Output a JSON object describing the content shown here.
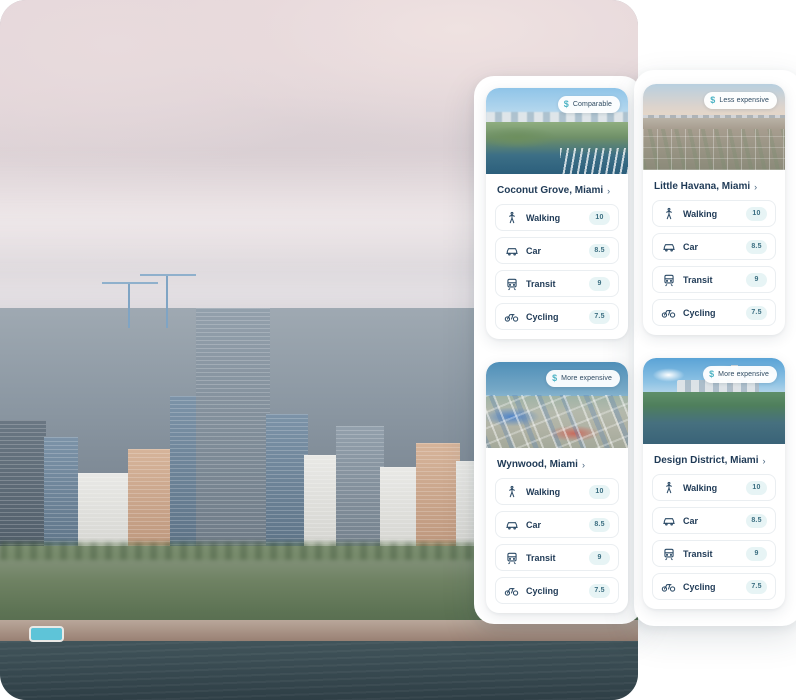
{
  "hero": {
    "alt": "aerial-photo-miami-brickell-waterfront-skyline"
  },
  "panels": [
    {
      "name": "left-card-panel"
    },
    {
      "name": "right-card-panel"
    }
  ],
  "badge_icon": "$",
  "title_chevron": "›",
  "cards": [
    {
      "id": "coconut-grove",
      "title": "Coconut Grove, Miami",
      "badge": "Comparable",
      "thumb_class": "coconut",
      "thumb_alt": "aerial-photo-coconut-grove-marina",
      "metrics": [
        {
          "icon": "walking-icon",
          "label": "Walking",
          "score": "10"
        },
        {
          "icon": "car-icon",
          "label": "Car",
          "score": "8.5"
        },
        {
          "icon": "transit-icon",
          "label": "Transit",
          "score": "9"
        },
        {
          "icon": "cycling-icon",
          "label": "Cycling",
          "score": "7.5"
        }
      ]
    },
    {
      "id": "little-havana",
      "title": "Little Havana, Miami",
      "badge": "Less expensive",
      "thumb_class": "havana",
      "thumb_alt": "aerial-photo-little-havana-street-grid",
      "metrics": [
        {
          "icon": "walking-icon",
          "label": "Walking",
          "score": "10"
        },
        {
          "icon": "car-icon",
          "label": "Car",
          "score": "8.5"
        },
        {
          "icon": "transit-icon",
          "label": "Transit",
          "score": "9"
        },
        {
          "icon": "cycling-icon",
          "label": "Cycling",
          "score": "7.5"
        }
      ]
    },
    {
      "id": "wynwood",
      "title": "Wynwood, Miami",
      "badge": "More expensive",
      "thumb_class": "wynwood",
      "thumb_alt": "aerial-photo-wynwood-warehouse-district",
      "metrics": [
        {
          "icon": "walking-icon",
          "label": "Walking",
          "score": "10"
        },
        {
          "icon": "car-icon",
          "label": "Car",
          "score": "8.5"
        },
        {
          "icon": "transit-icon",
          "label": "Transit",
          "score": "9"
        },
        {
          "icon": "cycling-icon",
          "label": "Cycling",
          "score": "7.5"
        }
      ]
    },
    {
      "id": "design-district",
      "title": "Design District, Miami",
      "badge": "More expensive",
      "thumb_class": "design",
      "thumb_alt": "aerial-photo-design-district-waterfront-towers",
      "metrics": [
        {
          "icon": "walking-icon",
          "label": "Walking",
          "score": "10"
        },
        {
          "icon": "car-icon",
          "label": "Car",
          "score": "8.5"
        },
        {
          "icon": "transit-icon",
          "label": "Transit",
          "score": "9"
        },
        {
          "icon": "cycling-icon",
          "label": "Cycling",
          "score": "7.5"
        }
      ]
    }
  ],
  "colors": {
    "badge_accent": "#4cb3c4",
    "score_bg": "#e7f4f5",
    "score_text": "#3c6f82",
    "title_text": "#1f3a56",
    "row_border": "#eaeef1"
  }
}
